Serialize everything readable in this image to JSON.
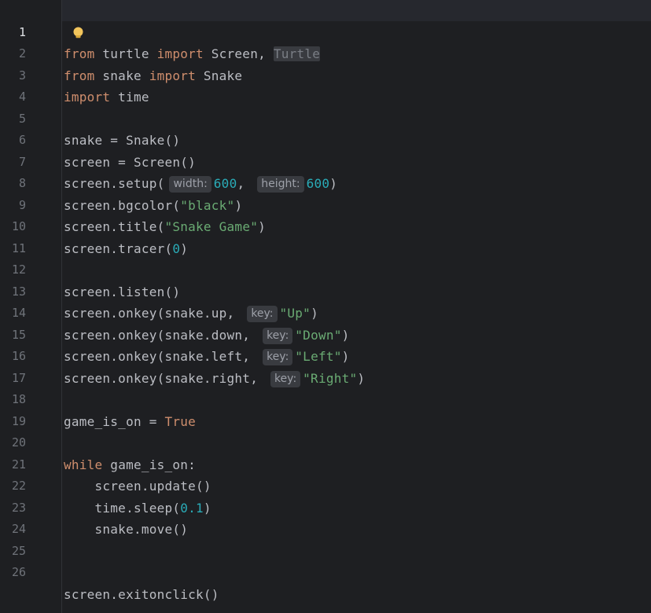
{
  "editor": {
    "active_line": "1",
    "intention_icon": "lightbulb-icon",
    "lines": [
      {
        "n": "1"
      },
      {
        "n": "2"
      },
      {
        "n": "3"
      },
      {
        "n": "4"
      },
      {
        "n": "5"
      },
      {
        "n": "6"
      },
      {
        "n": "7"
      },
      {
        "n": "8"
      },
      {
        "n": "9"
      },
      {
        "n": "10"
      },
      {
        "n": "11"
      },
      {
        "n": "12"
      },
      {
        "n": "13"
      },
      {
        "n": "14"
      },
      {
        "n": "15"
      },
      {
        "n": "16"
      },
      {
        "n": "17"
      },
      {
        "n": "18"
      },
      {
        "n": "19"
      },
      {
        "n": "20"
      },
      {
        "n": "21"
      },
      {
        "n": "22"
      },
      {
        "n": "23"
      },
      {
        "n": "24"
      },
      {
        "n": "25"
      },
      {
        "n": "26"
      }
    ],
    "tokens": {
      "l1": [
        "from",
        " turtle ",
        "import",
        " Screen, ",
        "Turtle"
      ],
      "l2": [
        "from",
        " snake ",
        "import",
        " Snake"
      ],
      "l3": [
        "import",
        " time"
      ],
      "l5": [
        "snake = Snake()"
      ],
      "l6": [
        "screen = Screen()"
      ],
      "l7": [
        "screen.setup(",
        "width:",
        "600",
        ", ",
        "height:",
        "600",
        ")"
      ],
      "l8": [
        "screen.bgcolor(",
        "\"black\"",
        ")"
      ],
      "l9": [
        "screen.title(",
        "\"Snake Game\"",
        ")"
      ],
      "l10": [
        "screen.tracer(",
        "0",
        ")"
      ],
      "l12": [
        "screen.listen()"
      ],
      "l13": [
        "screen.onkey(snake.up, ",
        "key:",
        "\"Up\"",
        ")"
      ],
      "l14": [
        "screen.onkey(snake.down, ",
        "key:",
        "\"Down\"",
        ")"
      ],
      "l15": [
        "screen.onkey(snake.left, ",
        "key:",
        "\"Left\"",
        ")"
      ],
      "l16": [
        "screen.onkey(snake.right, ",
        "key:",
        "\"Right\"",
        ")"
      ],
      "l18": [
        "game_is_on = ",
        "True"
      ],
      "l20": [
        "while",
        " game_is_on:"
      ],
      "l21": [
        "    screen.update()"
      ],
      "l22": [
        "    time.sleep(",
        "0.1",
        ")"
      ],
      "l23": [
        "    snake.move()"
      ],
      "l26": [
        "screen.exitonclick()"
      ]
    },
    "colors": {
      "background": "#1e1f22",
      "keyword": "#cf8e6d",
      "string": "#6aab73",
      "number": "#2aacb8",
      "text": "#bcbec4",
      "line_number": "#6f737a"
    }
  }
}
